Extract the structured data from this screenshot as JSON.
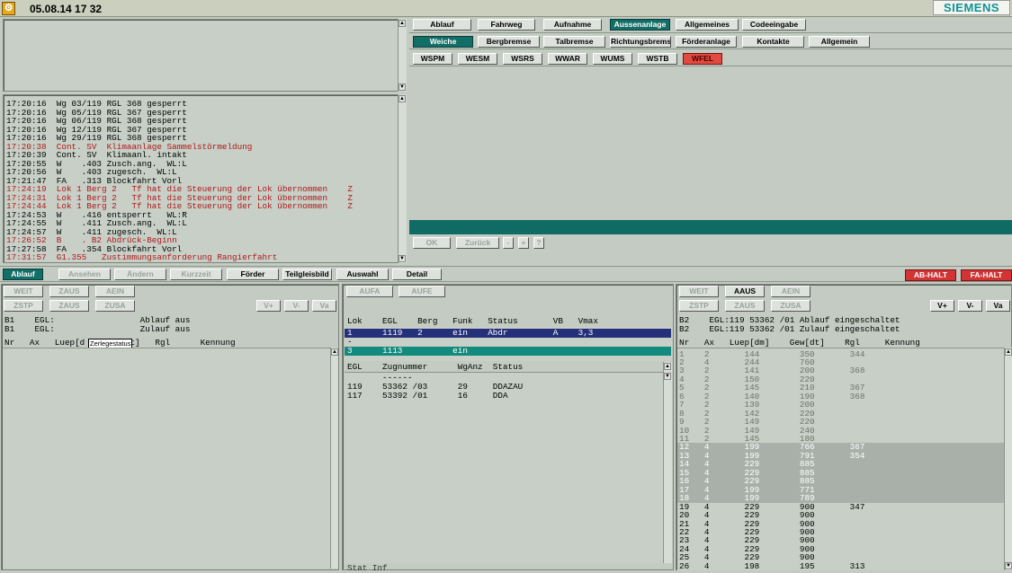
{
  "titlebar": {
    "datetime": "05.08.14  17 32",
    "brand": "SIEMENS"
  },
  "messages": [
    {
      "t": "17:20:16  Wg 03/119 RGL 368 gesperrt",
      "red": false
    },
    {
      "t": "17:20:16  Wg 05/119 RGL 367 gesperrt",
      "red": false
    },
    {
      "t": "17:20:16  Wg 06/119 RGL 368 gesperrt",
      "red": false
    },
    {
      "t": "17:20:16  Wg 12/119 RGL 367 gesperrt",
      "red": false
    },
    {
      "t": "17:20:16  Wg 29/119 RGL 368 gesperrt",
      "red": false
    },
    {
      "t": "17:20:38  Cont. SV  Klimaanlage Sammelstörmeldung",
      "red": true
    },
    {
      "t": "17:20:39  Cont. SV  Klimaanl. intakt",
      "red": false
    },
    {
      "t": "17:20:55  W    .403 Zusch.ang.  WL:L",
      "red": false
    },
    {
      "t": "17:20:56  W    .403 zugesch.  WL:L",
      "red": false
    },
    {
      "t": "17:21:47  FA   .313 Blockfahrt Vorl",
      "red": false
    },
    {
      "t": "17:24:19  Lok 1 Berg 2   Tf hat die Steuerung der Lok übernommen    Z",
      "red": true
    },
    {
      "t": "17:24:31  Lok 1 Berg 2   Tf hat die Steuerung der Lok übernommen    Z",
      "red": true
    },
    {
      "t": "17:24:44  Lok 1 Berg 2   Tf hat die Steuerung der Lok übernommen    Z",
      "red": true
    },
    {
      "t": "17:24:53  W    .416 entsperrt   WL:R",
      "red": false
    },
    {
      "t": "17:24:55  W    .411 Zusch.ang.  WL:L",
      "red": false
    },
    {
      "t": "17:24:57  W    .411 zugesch.  WL:L",
      "red": false
    },
    {
      "t": "17:26:52  B    . B2 Abdrück-Beginn",
      "red": true
    },
    {
      "t": "17:27:58  FA   .354 Blockfahrt Vorl",
      "red": false
    },
    {
      "t": "17:31:57  G1.355   Zustimmungsanforderung Rangierfahrt",
      "red": true
    }
  ],
  "tabs_top": [
    "Ablauf",
    "Fahrweg",
    "Aufnahme",
    "Aussenanlage",
    "Allgemeines",
    "Codeeingabe"
  ],
  "tabs_mid": [
    "Weiche",
    "Bergbremse",
    "Talbremse",
    "Richtungsbremse",
    "Förderanlage",
    "Kontakte",
    "Allgemein"
  ],
  "tabs_small": [
    "WSPM",
    "WESM",
    "WSRS",
    "WWAR",
    "WUMS",
    "WSTB",
    "WFEL"
  ],
  "ok_row": {
    "ok": "OK",
    "back": "Zurück",
    "minus": "-",
    "plus": "+",
    "help": "?"
  },
  "main_tabs": [
    "Ablauf",
    "Ansehen",
    "Ändern",
    "Kurzzeit",
    "Förder",
    "Teilgleisbild",
    "Auswahl",
    "Detail"
  ],
  "halt": {
    "ab": "AB-HALT",
    "fa": "FA-HALT"
  },
  "left": {
    "buttons1": [
      "WEIT",
      "ZAUS",
      "AEIN"
    ],
    "buttons2": [
      "ZSTP",
      "ZAUS",
      "ZUSA"
    ],
    "vbtns": [
      "V+",
      "V-",
      "Va"
    ],
    "line1": "B1    EGL:                 Ablauf aus",
    "line2": "B1    EGL:                 Zulauf aus",
    "header": "Nr   Ax   Luep[d      w[dt]   Rgl      Kennung",
    "tooltip": "Zerlegestatus"
  },
  "middle": {
    "buttons": [
      "AUFA",
      "AUFE"
    ],
    "lok_header": "Lok    EGL    Berg   Funk   Status       VB   Vmax",
    "lok_rows": [
      {
        "t": "1      1119   2      ein    Abdr         A    3,3",
        "style": "blue"
      },
      {
        "t": "-",
        "style": "plain"
      },
      {
        "t": "3      1113          ein",
        "style": "teal"
      }
    ],
    "egl_header": "EGL    Zugnummer      WgAnz  Status",
    "egl_rows": [
      "       ------",
      "119    53362 /03      29     DDAZAU",
      "117    53392 /01      16     DDA"
    ],
    "footer": "Stat Inf"
  },
  "right": {
    "buttons1": [
      "WEIT",
      "AAUS",
      "AEIN"
    ],
    "buttons2": [
      "ZSTP",
      "ZAUS",
      "ZUSA"
    ],
    "vbtns": [
      "V+",
      "V-",
      "Va"
    ],
    "line1": "B2    EGL:119 53362 /01 Ablauf eingeschaltet",
    "line2": "B2    EGL:119 53362 /01 Zulauf eingeschaltet",
    "header": "Nr   Ax   Luep[dm]    Gew[dt]    Rgl     Kennung",
    "rows": [
      {
        "t": "1    2       144        350       344",
        "s": "dim"
      },
      {
        "t": "2    4       244        760",
        "s": "dim"
      },
      {
        "t": "3    2       141        200       368",
        "s": "dim"
      },
      {
        "t": "4    2       150        220",
        "s": "dim"
      },
      {
        "t": "5    2       145        210       367",
        "s": "dim"
      },
      {
        "t": "6    2       140        190       368",
        "s": "dim"
      },
      {
        "t": "7    2       139        200",
        "s": "dim"
      },
      {
        "t": "8    2       142        220",
        "s": "dim"
      },
      {
        "t": "9    2       149        220",
        "s": "dim"
      },
      {
        "t": "10   2       149        240",
        "s": "dim"
      },
      {
        "t": "11   2       145        180",
        "s": "dim"
      },
      {
        "t": "12   4       199        766       367",
        "s": "hl"
      },
      {
        "t": "13   4       199        791       354",
        "s": "hl"
      },
      {
        "t": "14   4       229        885",
        "s": "hl"
      },
      {
        "t": "15   4       229        885",
        "s": "hl"
      },
      {
        "t": "16   4       229        885",
        "s": "hl"
      },
      {
        "t": "17   4       199        771",
        "s": "hl"
      },
      {
        "t": "18   4       199        789",
        "s": "hl"
      },
      {
        "t": "19   4       229        900       347",
        "s": "n"
      },
      {
        "t": "20   4       229        900",
        "s": "n"
      },
      {
        "t": "21   4       229        900",
        "s": "n"
      },
      {
        "t": "22   4       229        900",
        "s": "n"
      },
      {
        "t": "23   4       229        900",
        "s": "n"
      },
      {
        "t": "24   4       229        900",
        "s": "n"
      },
      {
        "t": "25   4       229        900",
        "s": "n"
      },
      {
        "t": "26   4       198        195       313",
        "s": "n"
      }
    ]
  }
}
